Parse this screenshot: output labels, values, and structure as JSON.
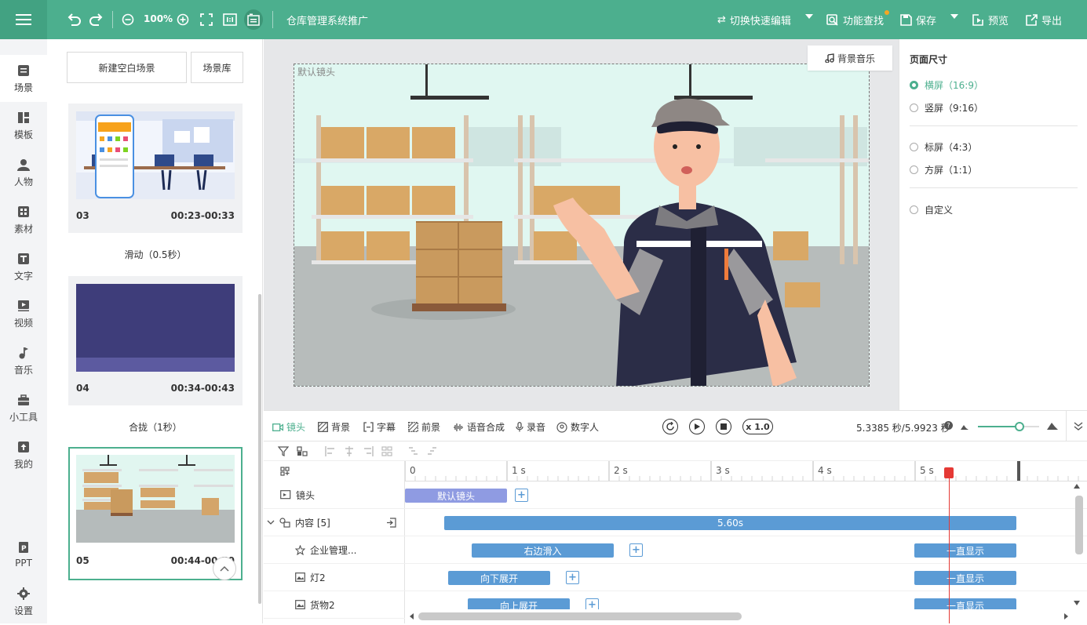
{
  "topbar": {
    "zoom": "100%",
    "project_title": "仓库管理系统推广",
    "switch_edit_label": "切换快速编辑",
    "find_feature_label": "功能查找",
    "save_label": "保存",
    "preview_label": "预览",
    "export_label": "导出"
  },
  "nav": [
    {
      "label": "场景",
      "icon": "scene-icon"
    },
    {
      "label": "模板",
      "icon": "template-icon"
    },
    {
      "label": "人物",
      "icon": "person-icon"
    },
    {
      "label": "素材",
      "icon": "material-icon"
    },
    {
      "label": "文字",
      "icon": "text-icon"
    },
    {
      "label": "视频",
      "icon": "video-icon"
    },
    {
      "label": "音乐",
      "icon": "music-icon"
    },
    {
      "label": "小工具",
      "icon": "toolbox-icon"
    },
    {
      "label": "我的",
      "icon": "upload-icon"
    },
    {
      "label": "PPT",
      "icon": "ppt-icon"
    },
    {
      "label": "设置",
      "icon": "gear-icon"
    }
  ],
  "scenes_panel": {
    "new_blank_label": "新建空白场景",
    "library_label": "场景库",
    "cards": [
      {
        "num": "03",
        "time": "00:23-00:33"
      },
      {
        "num": "04",
        "time": "00:34-00:43"
      },
      {
        "num": "05",
        "time": "00:44-00:50"
      }
    ],
    "transitions": [
      "滑动（0.5秒）",
      "合拢（1秒）"
    ]
  },
  "canvas": {
    "frame_label": "默认镜头",
    "music_label": "背景音乐"
  },
  "page_size": {
    "title": "页面尺寸",
    "options": [
      "横屏（16:9）",
      "竖屏（9:16）",
      "标屏（4:3）",
      "方屏（1:1）",
      "自定义"
    ],
    "selected": "横屏（16:9）"
  },
  "timeline": {
    "tabs": [
      "镜头",
      "背景",
      "字幕",
      "前景",
      "语音合成",
      "录音",
      "数字人"
    ],
    "speed": "x 1.0",
    "time_readout": "5.3385 秒/5.9923 秒",
    "ruler_labels": [
      "0",
      "1 s",
      "2 s",
      "3 s",
      "4 s",
      "5 s"
    ],
    "tracks": [
      {
        "label": "镜头",
        "blocks": [
          "默认镜头"
        ]
      },
      {
        "label": "内容 [5]",
        "blocks": [
          "5.60s"
        ]
      },
      {
        "label": "企业管理...",
        "blocks": [
          "右边滑入",
          "一直显示"
        ]
      },
      {
        "label": "灯2",
        "blocks": [
          "向下展开",
          "一直显示"
        ]
      },
      {
        "label": "货物2",
        "blocks": [
          "向上展开",
          "一直显示"
        ]
      }
    ]
  },
  "colors": {
    "accent": "#4caf8e",
    "block": "#5b9bd5",
    "camera_block": "#8f9be2",
    "playhead": "#e53935"
  }
}
